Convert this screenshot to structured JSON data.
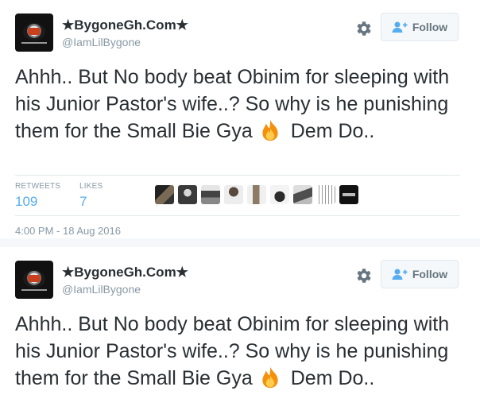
{
  "tweets": [
    {
      "display_name": "★BygoneGh.Com★",
      "handle": "@IamLilBygone",
      "follow_label": "Follow",
      "text_before_emoji": "Ahhh.. But No body beat Obinim for sleeping with his Junior Pastor's wife..? So why is he punishing them for the Small Bie Gya",
      "emoji": "fire-icon",
      "text_after_emoji": "Dem Do..",
      "retweets_label": "RETWEETS",
      "retweets_count": "109",
      "likes_label": "LIKES",
      "likes_count": "7",
      "likers": [
        "liker-avatar-1",
        "liker-avatar-2",
        "liker-avatar-3",
        "liker-avatar-4",
        "liker-avatar-5",
        "liker-avatar-6",
        "liker-avatar-7",
        "liker-avatar-8",
        "liker-avatar-9"
      ],
      "timestamp": "4:00 PM - 18 Aug 2016"
    },
    {
      "display_name": "★BygoneGh.Com★",
      "handle": "@IamLilBygone",
      "follow_label": "Follow",
      "text_before_emoji": "Ahhh.. But No body beat Obinim for sleeping with his Junior Pastor's wife..? So why is he punishing them for the Small Bie Gya",
      "emoji": "fire-icon",
      "text_after_emoji": "Dem Do.."
    }
  ],
  "colors": {
    "link_blue": "#55acee",
    "muted_gray": "#8899a6",
    "text_dark": "#292f33",
    "border": "#e1e8ed"
  }
}
